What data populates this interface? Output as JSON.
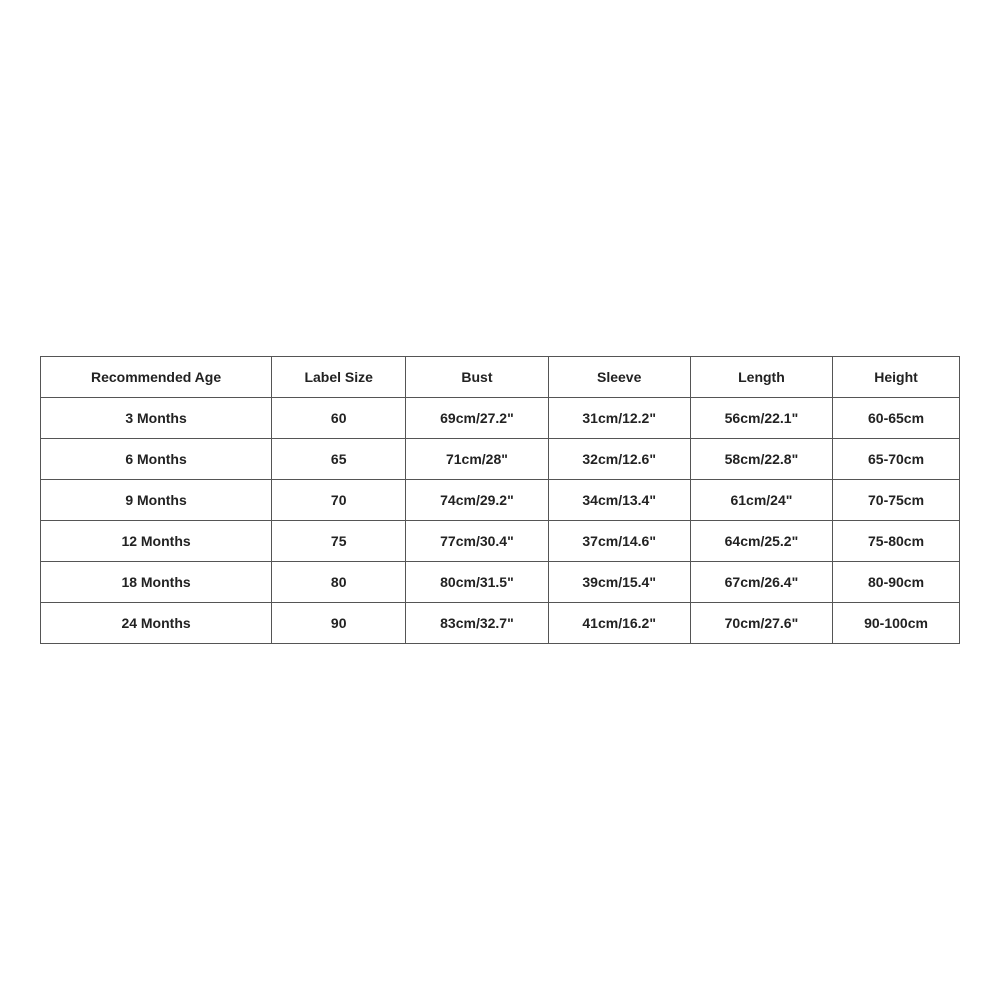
{
  "table": {
    "headers": [
      "Recommended Age",
      "Label Size",
      "Bust",
      "Sleeve",
      "Length",
      "Height"
    ],
    "rows": [
      {
        "age": "3 Months",
        "label_size": "60",
        "bust": "69cm/27.2\"",
        "sleeve": "31cm/12.2\"",
        "length": "56cm/22.1\"",
        "height": "60-65cm"
      },
      {
        "age": "6 Months",
        "label_size": "65",
        "bust": "71cm/28\"",
        "sleeve": "32cm/12.6\"",
        "length": "58cm/22.8\"",
        "height": "65-70cm"
      },
      {
        "age": "9 Months",
        "label_size": "70",
        "bust": "74cm/29.2\"",
        "sleeve": "34cm/13.4\"",
        "length": "61cm/24\"",
        "height": "70-75cm"
      },
      {
        "age": "12 Months",
        "label_size": "75",
        "bust": "77cm/30.4\"",
        "sleeve": "37cm/14.6\"",
        "length": "64cm/25.2\"",
        "height": "75-80cm"
      },
      {
        "age": "18 Months",
        "label_size": "80",
        "bust": "80cm/31.5\"",
        "sleeve": "39cm/15.4\"",
        "length": "67cm/26.4\"",
        "height": "80-90cm"
      },
      {
        "age": "24 Months",
        "label_size": "90",
        "bust": "83cm/32.7\"",
        "sleeve": "41cm/16.2\"",
        "length": "70cm/27.6\"",
        "height": "90-100cm"
      }
    ]
  }
}
